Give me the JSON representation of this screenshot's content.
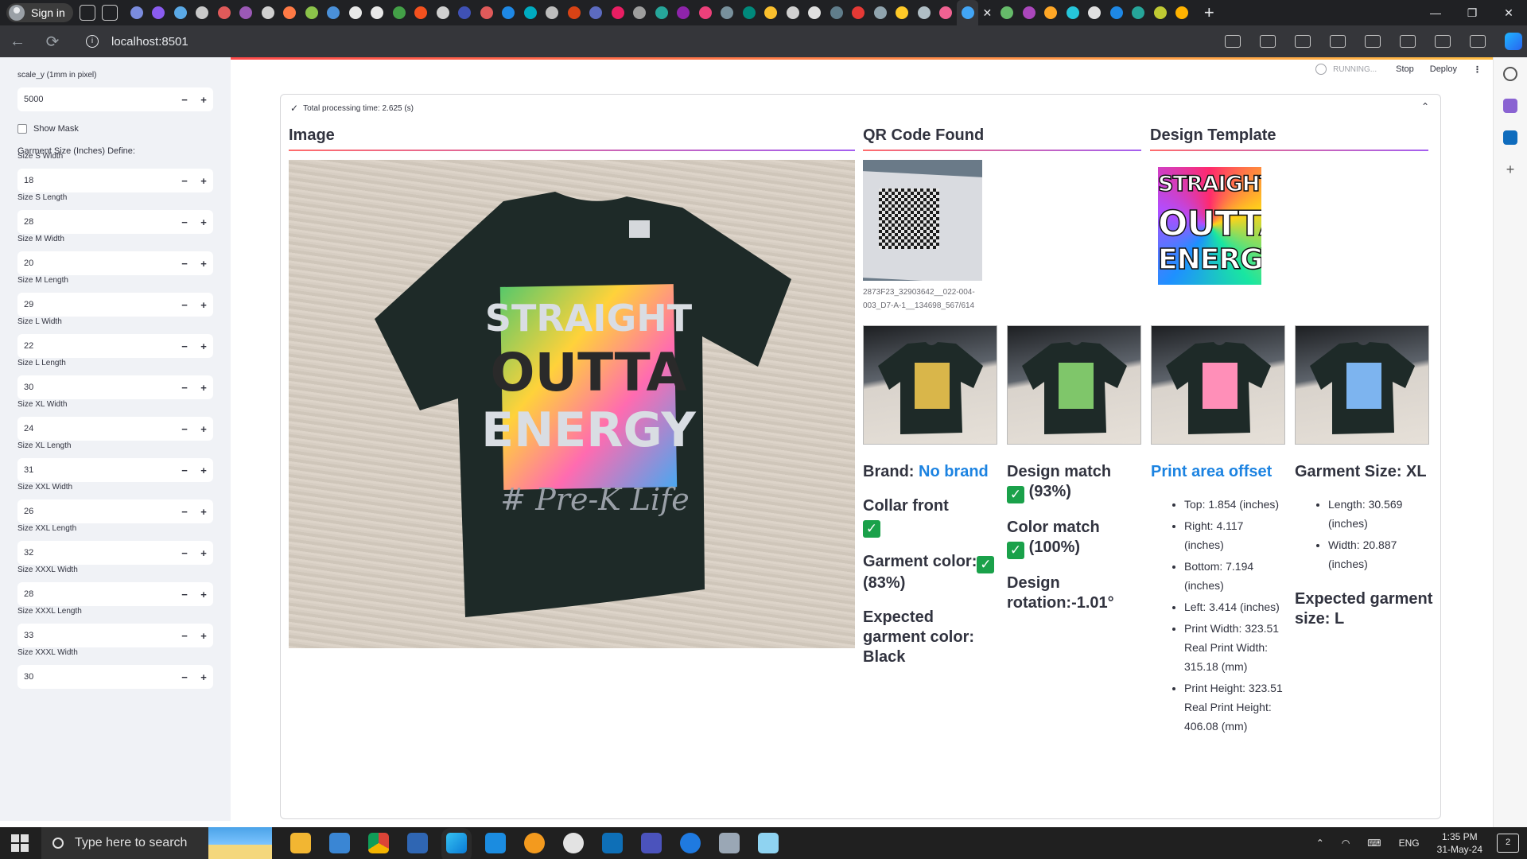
{
  "browser": {
    "profile_label": "Sign in",
    "url": "localhost:8501",
    "tab_colors": [
      "#7b8cde",
      "#8a5cf0",
      "#5aa9e6",
      "#c9c9c9",
      "#e05a5a",
      "#9b59b6",
      "#d0d0d0",
      "#ff7a45",
      "#8bc34a",
      "#4a90d9",
      "#e8e8e8",
      "#e8e8e8",
      "#43a047",
      "#f4511e",
      "#d0d0d0",
      "#3f51b5",
      "#e05a5a",
      "#1e88e5",
      "#00acc1",
      "#bdbdbd",
      "#d84315",
      "#5c6bc0",
      "#e91e63",
      "#9e9e9e",
      "#26a69a",
      "#8e24aa",
      "#ec407a",
      "#78909c",
      "#00897b",
      "#fbc02d",
      "#d0d0d0",
      "#e0e0e0",
      "#607d8b",
      "#e53935",
      "#90a4ae",
      "#ffca28",
      "#b0bec5",
      "#f06292",
      "#42a5f5",
      "#66bb6a",
      "#ab47bc",
      "#ffa726",
      "#26c6da",
      "#e0e0e0",
      "#1e88e5",
      "#26a69a",
      "#c0ca33",
      "#ffb300"
    ]
  },
  "toolbar": {
    "running": "RUNNING...",
    "stop": "Stop",
    "deploy": "Deploy"
  },
  "sidebar": {
    "scale_label": "scale_y (1mm in pixel)",
    "scale_value": "5000",
    "show_mask": "Show Mask",
    "garment_define": "Garment Size (Inches) Define:",
    "fields": [
      {
        "label": "Size S Width",
        "value": "18"
      },
      {
        "label": "Size S Length",
        "value": "28"
      },
      {
        "label": "Size M Width",
        "value": "20"
      },
      {
        "label": "Size M Length",
        "value": "29"
      },
      {
        "label": "Size L Width",
        "value": "22"
      },
      {
        "label": "Size L Length",
        "value": "30"
      },
      {
        "label": "Size XL Width",
        "value": "24"
      },
      {
        "label": "Size XL Length",
        "value": "31"
      },
      {
        "label": "Size XXL Width",
        "value": "26"
      },
      {
        "label": "Size XXL Length",
        "value": "32"
      },
      {
        "label": "Size XXXL Width",
        "value": "28"
      },
      {
        "label": "Size XXXL Length",
        "value": "33"
      },
      {
        "label": "Size XXXL Width",
        "value": "30"
      }
    ]
  },
  "expander": {
    "title": "Total processing time: 2.625 (s)"
  },
  "headers": {
    "image": "Image",
    "qr": "QR Code Found",
    "template": "Design Template"
  },
  "shirt_text": {
    "l1": "STRAIGHT",
    "l2": "OUTTA",
    "l3": "ENERGY",
    "l4": "# Pre-K Life"
  },
  "qr_caption": "2873F23_32903642__022-004-003_D7-A-1__134698_567/614",
  "results": {
    "brand_label": "Brand: ",
    "brand_value": "No brand",
    "collar": "Collar front",
    "garment_color": "Garment color:",
    "garment_color_pct": "(83%)",
    "expected_color": "Expected garment color: Black",
    "design_match": "Design match",
    "design_match_pct": "(93%)",
    "color_match": "Color match",
    "color_match_pct": "(100%)",
    "rotation": "Design rotation:-1.01°",
    "offset_title": "Print area offset",
    "offsets": [
      "Top: 1.854 (inches)",
      "Right: 4.117 (inches)",
      "Bottom: 7.194 (inches)",
      "Left: 3.414 (inches)",
      "Print Width: 323.51 Real Print Width: 315.18 (mm)",
      "Print Height: 323.51 Real Print Height: 406.08 (mm)"
    ],
    "garment_size_title": "Garment Size: XL",
    "sizes": [
      "Length: 30.569 (inches)",
      "Width: 20.887 (inches)"
    ],
    "expected_size": "Expected garment size: L"
  },
  "taskbar": {
    "search_placeholder": "Type here to search",
    "lang": "ENG",
    "time": "1:35 PM",
    "date": "31-May-24",
    "notifications": "2"
  }
}
